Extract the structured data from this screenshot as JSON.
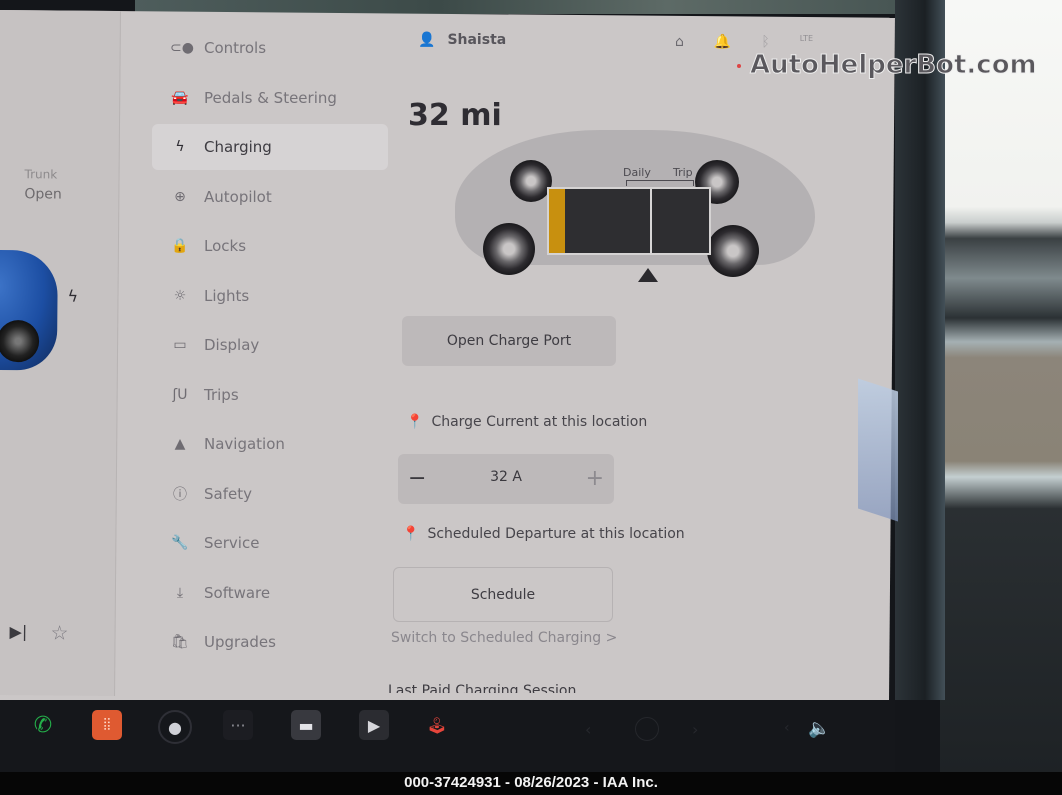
{
  "left_panel": {
    "trunk_label": "Trunk",
    "trunk_value": "Open",
    "charge_icon": "lightning-bolt-icon",
    "media_next_icon": "skip-next-icon",
    "favorite_icon": "star-icon"
  },
  "sidebar": {
    "items": [
      {
        "label": "Controls",
        "icon": "toggle-icon",
        "glyph": "⊂●",
        "active": false
      },
      {
        "label": "Pedals & Steering",
        "icon": "car-icon",
        "glyph": "🚘",
        "active": false
      },
      {
        "label": "Charging",
        "icon": "lightning-bolt-icon",
        "glyph": "ϟ",
        "active": true
      },
      {
        "label": "Autopilot",
        "icon": "steering-wheel-icon",
        "glyph": "⊕",
        "active": false
      },
      {
        "label": "Locks",
        "icon": "lock-icon",
        "glyph": "🔒",
        "active": false
      },
      {
        "label": "Lights",
        "icon": "sun-icon",
        "glyph": "☼",
        "active": false
      },
      {
        "label": "Display",
        "icon": "display-icon",
        "glyph": "▭",
        "active": false
      },
      {
        "label": "Trips",
        "icon": "route-icon",
        "glyph": "ʃU",
        "active": false
      },
      {
        "label": "Navigation",
        "icon": "navigation-arrow-icon",
        "glyph": "▲",
        "active": false
      },
      {
        "label": "Safety",
        "icon": "alert-circle-icon",
        "glyph": "ⓘ",
        "active": false
      },
      {
        "label": "Service",
        "icon": "wrench-icon",
        "glyph": "🔧",
        "active": false
      },
      {
        "label": "Software",
        "icon": "download-icon",
        "glyph": "⤓",
        "active": false
      },
      {
        "label": "Upgrades",
        "icon": "shopping-bag-icon",
        "glyph": "🛍",
        "active": false
      }
    ]
  },
  "header": {
    "user_name": "Shaista",
    "status_icons": [
      "garage-icon",
      "bell-icon",
      "bluetooth-icon",
      "lte-signal-icon"
    ],
    "lte_label": "LTE"
  },
  "watermark": "AutoHelperBot.com",
  "charging": {
    "range": "32 mi",
    "battery_level": 0.1,
    "charge_limit": 0.63,
    "daily_label": "Daily",
    "trip_label": "Trip",
    "battery_fill_color": "#c8900f",
    "open_port_label": "Open Charge Port",
    "charge_current_label": "Charge Current at this location",
    "charge_current_value": "32 A",
    "minus_label": "−",
    "plus_label": "+",
    "scheduled_departure_label": "Scheduled Departure at this location",
    "schedule_button": "Schedule",
    "switch_link": "Switch to Scheduled Charging >",
    "cutoff_text": "Last Paid Charging Session"
  },
  "taskbar": {
    "apps": [
      {
        "name": "phone-icon",
        "glyph": "✆"
      },
      {
        "name": "voice-command-icon",
        "glyph": "⦙⦙"
      },
      {
        "name": "camera-icon",
        "glyph": "●"
      },
      {
        "name": "more-apps-icon",
        "glyph": "···"
      },
      {
        "name": "calendar-icon",
        "glyph": "▬"
      },
      {
        "name": "video-icon",
        "glyph": "▶"
      },
      {
        "name": "games-joystick-icon",
        "glyph": "🕹"
      }
    ],
    "prev_glyph": "‹",
    "next_glyph": "›",
    "vol_down_glyph": "‹",
    "volume_glyph": "🔈"
  },
  "caption": "000-37424931 - 08/26/2023 - IAA Inc."
}
